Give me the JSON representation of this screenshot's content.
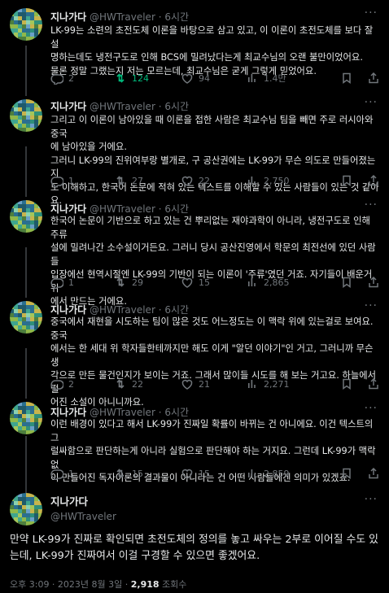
{
  "author": {
    "name": "지나가다",
    "handle": "@HWTraveler"
  },
  "dot": "·",
  "more_icon": "more-icon",
  "tweets": [
    {
      "time": "6시간",
      "text": "LK-99는 소련의 초전도체 이론을 바탕으로 삼고 있고, 이 이론이 초전도체를 보다 잘 설\n명하는데도 냉전구도로 인해 BCS에 밀려났다는게 최교수님의 오랜 불만이었어요.\n물론 정말 그랬는지 저는 모르는데, 최교수님은 굳게 그렇게 믿었어요.",
      "replies": "2",
      "retweets": "124",
      "likes": "94",
      "views": "1.4만",
      "retweeted": true
    },
    {
      "time": "6시간",
      "text": "그리고 이 이론이 남아있을 때 이론을 접한 사람은 최교수님 팀을 빼면 주로 러시아와 중국\n에 남아있을 거에요.\n그러니 LK-99의 진위여부랑 별개로, 구 공산권에는 LK-99가 무슨 의도로 만들어졌는지\n도 이해하고, 한국어 논문에 적혀 있는 텍스트를 이해할 수 있는 사람들이 있는 것 같아요.",
      "replies": "1",
      "retweets": "27",
      "likes": "22",
      "views": "2,750",
      "retweeted": false
    },
    {
      "time": "6시간",
      "text": "한국어 논문이 기반으로 하고 있는 건 뿌리없는 재야과학이 아니라, 냉전구도로 인해 주류\n설에 밀려나간 소수설이거든요. 그러니 당시 공산진영에서 학문의 최전선에 있던 사람들\n입장에선 현역시절엔 LK-99의 기반이 되는 이론이 '주류'였던 거죠. 자기들이 배운거 위\n에서 만드는 거에요.",
      "replies": "1",
      "retweets": "29",
      "likes": "15",
      "views": "2,865",
      "retweeted": false
    },
    {
      "time": "6시간",
      "text": "중국에서 재현을 시도하는 팀이 많은 것도 어느정도는 이 맥락 위에 있는걸로 보여요. 중국\n에서는 한 세대 위 학자들한테까지만 해도 이게 \"알던 이야기\"인 거고, 그러니까 무슨 생\n각으로 만든 물건인지가 보이는 거죠. 그래서 많이들 시도를 해 보는 거고요. 하늘에서 떨\n어진 소설이 아니니까요.",
      "replies": "2",
      "retweets": "22",
      "likes": "21",
      "views": "2,271",
      "retweeted": false
    },
    {
      "time": "6시간",
      "text": "이런 배경이 있다고 해서 LK-99가 진짜일 확률이 바뀌는 건 아니에요. 이건 텍스트의 그\n럴싸함으로 판단하는게 아니라 실험으로 판단해야 하는 거지요. 그런데 LK-99가 맥락 없\n이 만들어진 독자이론의 결과물이 아니라는 건 어떤 사람들에겐 의미가 있겠죠.",
      "replies": "1",
      "retweets": "15",
      "likes": "15",
      "views": "2,859",
      "retweeted": false
    }
  ],
  "main_tweet": {
    "text": "만약 LK-99가 진짜로 확인되면 초전도체의 정의를 놓고 싸우는 2부로 이어질 수도 있\n는데, LK-99가 진짜여서 이걸 구경할 수 있으면 좋겠어요.",
    "time": "오후 3:09 · 2023년 8월 3일 ·",
    "views_count": "2,918",
    "views_label": "조회수"
  }
}
